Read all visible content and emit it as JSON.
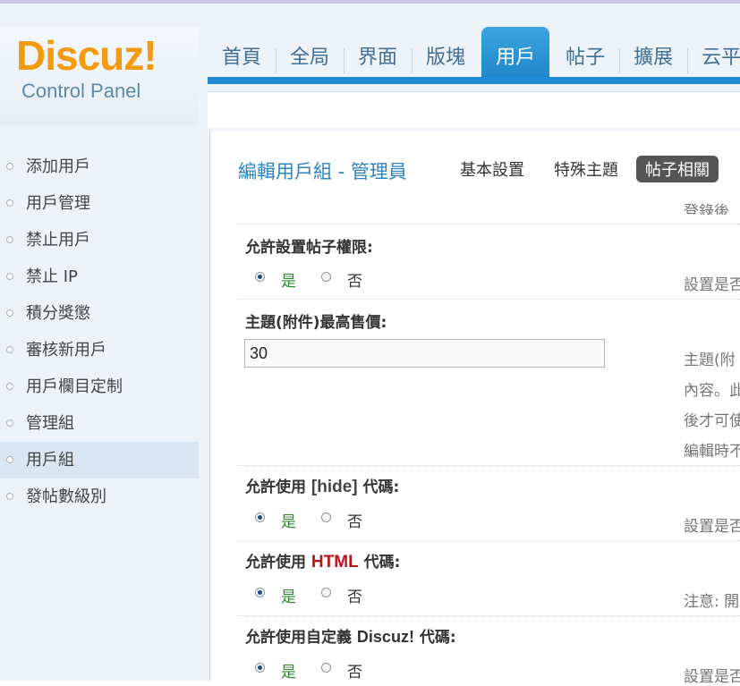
{
  "logo": {
    "word": "Discuz!",
    "sub": "Control Panel"
  },
  "nav": {
    "items": [
      "首頁",
      "全局",
      "界面",
      "版塊",
      "用戶",
      "帖子",
      "擴展",
      "云平"
    ],
    "active_index": 4
  },
  "sidebar": {
    "items": [
      "添加用戶",
      "用戶管理",
      "禁止用戶",
      "禁止 IP",
      "積分獎懲",
      "審核新用戶",
      "用戶欄目定制",
      "管理組",
      "用戶組",
      "發帖數級別"
    ],
    "active_index": 8
  },
  "main": {
    "page_title": "編輯用戶組 - 管理員",
    "tabs": [
      "基本設置",
      "特殊主題",
      "帖子相關"
    ],
    "active_tab": 2,
    "top_tip_fragment": "登錄後",
    "settings": [
      {
        "label": "允許設置帖子權限:",
        "yes": "是",
        "no": "否",
        "value": "yes",
        "tip": "設置是否"
      },
      {
        "label": "主題(附件)最高售價:",
        "input_value": "30",
        "tip_lines": [
          "主題(附",
          "內容。此",
          "後才可使",
          "編輯時不"
        ]
      },
      {
        "label_before": "允許使用 ",
        "label_code": "[hide]",
        "label_after": " 代碼:",
        "yes": "是",
        "no": "否",
        "value": "yes",
        "tip": "設置是否"
      },
      {
        "label_before": "允許使用 ",
        "label_code": "HTML",
        "label_after": " 代碼:",
        "yes": "是",
        "no": "否",
        "value": "yes",
        "tip": "注意: 開"
      },
      {
        "label_before": "允許使用自定義 ",
        "label_code": "Discuz!",
        "label_after": " 代碼:",
        "yes": "是",
        "no": "否",
        "value": "yes",
        "tip": "設置是否"
      }
    ]
  }
}
